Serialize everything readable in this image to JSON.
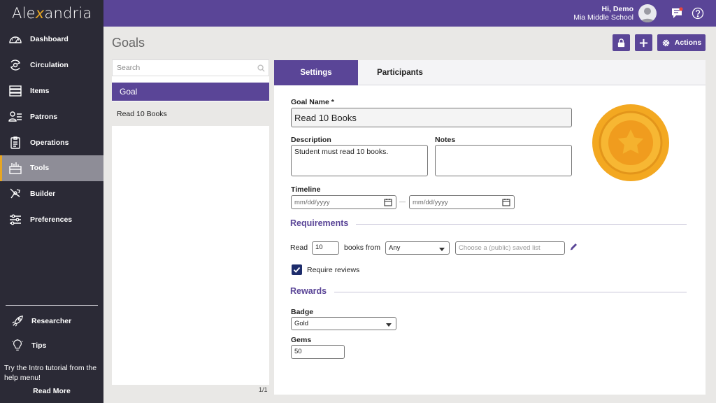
{
  "app": {
    "logo_pre": "Ale",
    "logo_x": "x",
    "logo_post": "andria"
  },
  "sidebar": {
    "items": [
      {
        "label": "Dashboard",
        "icon": "dashboard-icon"
      },
      {
        "label": "Circulation",
        "icon": "circulation-icon"
      },
      {
        "label": "Items",
        "icon": "items-icon"
      },
      {
        "label": "Patrons",
        "icon": "patrons-icon"
      },
      {
        "label": "Operations",
        "icon": "operations-icon"
      },
      {
        "label": "Tools",
        "icon": "tools-icon",
        "active": true
      },
      {
        "label": "Builder",
        "icon": "builder-icon"
      },
      {
        "label": "Preferences",
        "icon": "preferences-icon"
      }
    ],
    "researcher": "Researcher",
    "tips": "Tips",
    "tip_text": "Try the Intro tutorial from the help menu!",
    "read_more": "Read More"
  },
  "header": {
    "greeting": "Hi, Demo",
    "school": "Mia Middle School"
  },
  "page": {
    "title": "Goals",
    "actions_label": "Actions"
  },
  "list": {
    "search_placeholder": "Search",
    "header": "Goal",
    "rows": [
      "Read 10 Books"
    ],
    "pager": "1/1"
  },
  "tabs": {
    "settings": "Settings",
    "participants": "Participants"
  },
  "form": {
    "goal_name_label": "Goal Name *",
    "goal_name_value": "Read 10 Books",
    "description_label": "Description",
    "description_value": "Student must read 10 books.",
    "notes_label": "Notes",
    "notes_value": "",
    "timeline_label": "Timeline",
    "date_placeholder": "mm/dd/yyyy",
    "date_separator": "—",
    "requirements_heading": "Requirements",
    "read_label": "Read",
    "read_count": "10",
    "books_from_label": "books from",
    "source_selected": "Any",
    "saved_list_placeholder": "Choose a (public) saved list",
    "require_reviews_label": "Require reviews",
    "require_reviews_checked": true,
    "rewards_heading": "Rewards",
    "badge_label": "Badge",
    "badge_selected": "Gold",
    "gems_label": "Gems",
    "gems_value": "50"
  },
  "colors": {
    "brand": "#5a4597",
    "sidebar": "#2b2a36",
    "accent": "#e7a623",
    "badge_gold": "#f3a821"
  }
}
